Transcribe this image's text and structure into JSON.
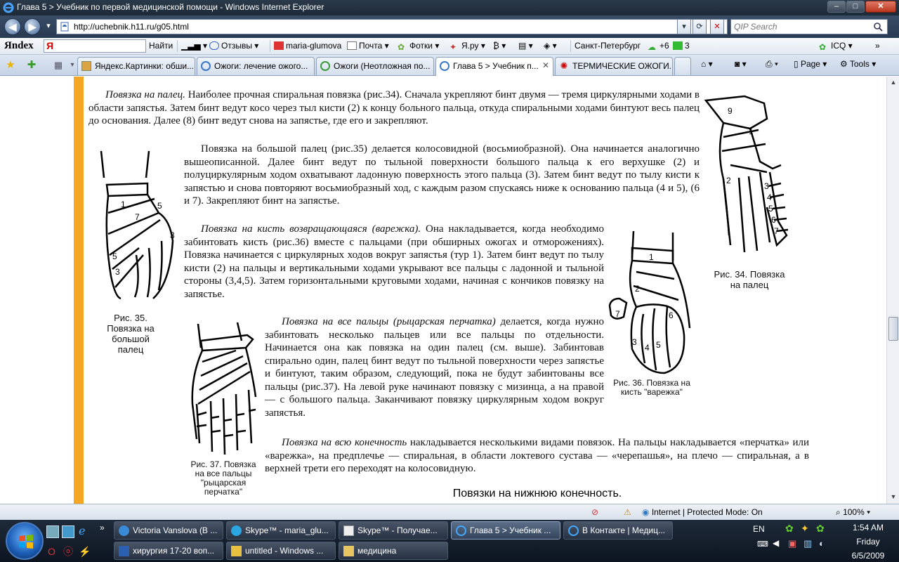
{
  "window": {
    "title": "Глава 5 > Учебник по первой медицинской помощи - Windows Internet Explorer",
    "minimize": "–",
    "maximize": "□",
    "close": "✕"
  },
  "address": {
    "url": "http://uchebnik.h11.ru/g05.html",
    "search_placeholder": "QIP Search"
  },
  "yandex_bar": {
    "logo": "Яndex",
    "find_button": "Найти",
    "reviews": "Отзывы",
    "user": "maria-glumova",
    "mail": "Почта",
    "photos": "Фотки",
    "yaru": "Я.ру",
    "city": "Санкт-Петербург",
    "weather": "+6",
    "traffic": "3",
    "icq": "ICQ"
  },
  "tabs": [
    {
      "label": "Яндекс.Картинки: обши..."
    },
    {
      "label": "Ожоги: лечение ожого..."
    },
    {
      "label": "Ожоги (Неотложная по..."
    },
    {
      "label": "Глава 5 > Учебник п..."
    },
    {
      "label": "ТЕРМИЧЕСКИЕ ОЖОГИ..."
    }
  ],
  "command_bar": {
    "page": "Page",
    "tools": "Tools"
  },
  "content": {
    "p1_em": "Повязка на палец.",
    "p1": " Наиболее прочная спиральная повязка (рис.34). Сначала укрепляют бинт двумя — тремя циркулярными ходами в области запястья. Затем бинт ведут косо через тыл кисти (2) к концу больного пальца, откуда спиральными ходами бинтуют весь палец до основания. Далее (8) бинт ведут снова на запястье, где его и закрепляют.",
    "p2": "Повязка на большой палец (рис.35) делается колосовидной (восьмиобразной). Она начинается аналогично вышеописанной. Далее бинт ведут по тыльной поверхности большого пальца к его верхушке (2) и полуциркулярным ходом охватывают ладонную поверхность этого пальца (3). Затем бинт ведут по тылу кисти к запястью и снова повторяют восьмиобразный ход, с каждым разом спускаясь ниже к основанию пальца (4 и 5), (6 и 7). Закрепляют бинт на запястье.",
    "p3_em": "Повязка на кисть возвращающаяся (варежка).",
    "p3": " Она накладывается, когда необходимо забинтовать кисть (рис.36) вместе с пальцами (при обширных ожогах и отморожениях). Повязка начинается с циркулярных ходов вокруг запястья (тур 1). Затем бинт ведут по тылу кисти (2) на пальцы и вертикальными ходами укрывают все пальцы с ладонной и тыльной стороны (3,4,5). Затем горизонтальными круговыми ходами, начиная с кончиков повязку на запястье.",
    "p4_em": "Повязка на все пальцы (рыцарская перчатка)",
    "p4": " делается, когда нужно забинтовать несколько пальцев или все пальцы по отдельности. Начинается она как повязка на один палец (см. выше). Забинтовав спирально один, палец бинт ведут по тыльной поверхности через запястье и бинтуют, таким образом, следующий, пока не будут забинтованы все пальцы (рис.37). На левой руке начинают повязку с мизинца, а на правой — с большого пальца. Заканчивают повязку циркулярным ходом вокруг запястья.",
    "p5_em": "Повязка на всю конечность",
    "p5": " накладывается несколькими видами повязок. На пальцы накладывается «перчатка» или «варежка», на предплечье — спиральная, в области локтевого сустава — «черепашья», на плечо — спиральная, а в верхней трети его переходят на колосовидную.",
    "subtitle": "Повязки на нижнюю конечность.",
    "cap34": "Рис. 34. Повязка на палец",
    "cap35": "Рис. 35. Повязка на большой палец",
    "cap36": "Рис. 36. Повязка на кисть \"варежка\"",
    "cap37": "Рис. 37. Повязка на все пальцы \"рыцарская перчатка\"",
    "fig34_labels": [
      "9",
      "1",
      "2",
      "3",
      "4",
      "5",
      "6",
      "7"
    ],
    "fig35_labels": [
      "1",
      "7",
      "5",
      "3",
      "5",
      "3"
    ],
    "fig36_labels": [
      "1",
      "2",
      "6",
      "7",
      "3",
      "4",
      "5"
    ]
  },
  "status": {
    "zone": "Internet | Protected Mode: On",
    "zoom": "100%"
  },
  "taskbar": {
    "tasks_top": [
      {
        "label": "Victoria Vanslova (В ..."
      },
      {
        "label": "Skype™ - maria_glu..."
      },
      {
        "label": "Skype™ - Получае..."
      },
      {
        "label": "Глава 5 > Учебник ..."
      },
      {
        "label": "В Контакте | Медиц..."
      }
    ],
    "tasks_bottom": [
      {
        "label": "хирургия 17-20 воп..."
      },
      {
        "label": "untitled - Windows ..."
      },
      {
        "label": "медицина"
      }
    ],
    "lang": "EN",
    "time": "1:54 AM",
    "day": "Friday",
    "date": "6/5/2009"
  }
}
